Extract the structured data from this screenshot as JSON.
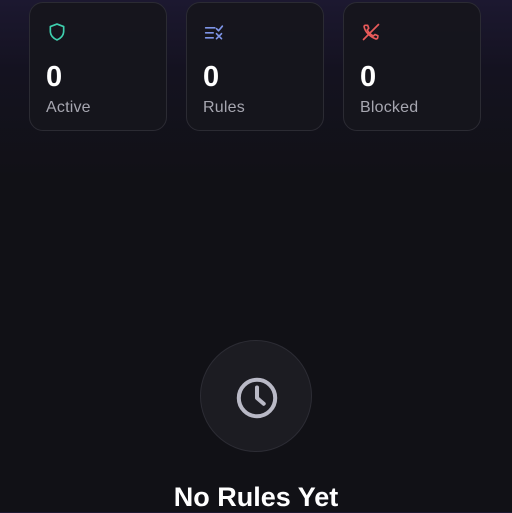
{
  "stats": [
    {
      "icon": "shield-icon",
      "color": "#3ecfae",
      "value": "0",
      "label": "Active"
    },
    {
      "icon": "rules-list-icon",
      "color": "#7e95e8",
      "value": "0",
      "label": "Rules"
    },
    {
      "icon": "blocked-call-icon",
      "color": "#e85a5a",
      "value": "0",
      "label": "Blocked"
    }
  ],
  "empty_state": {
    "icon": "clock-icon",
    "title": "No Rules Yet"
  }
}
